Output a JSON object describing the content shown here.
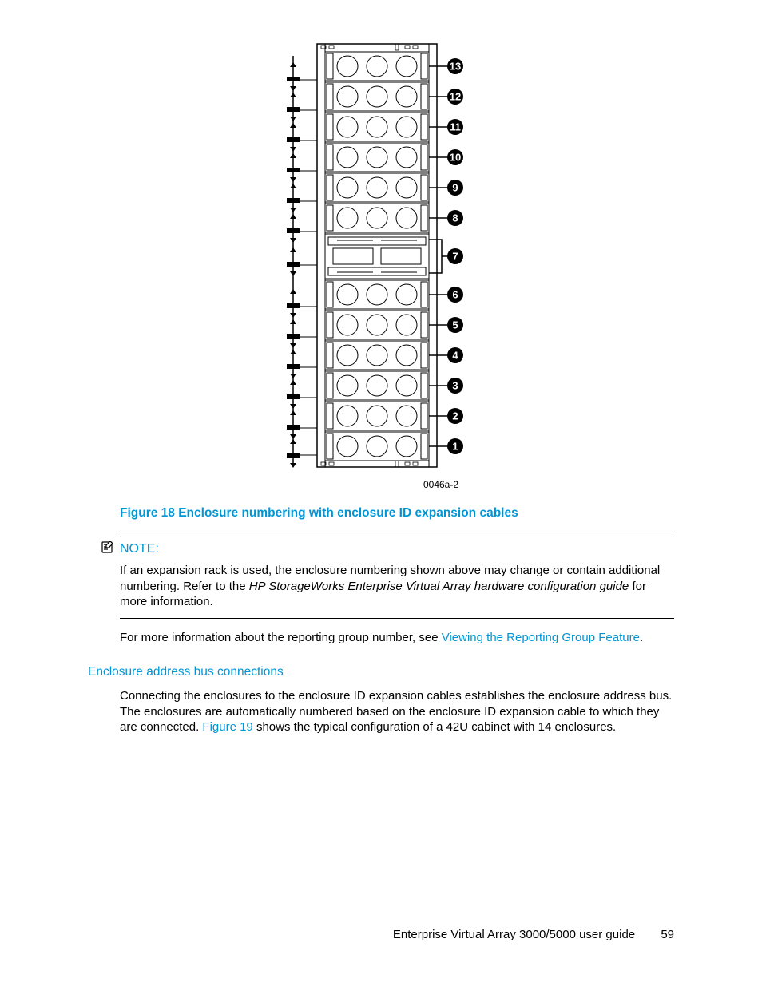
{
  "figure": {
    "image_id": "0046a-2",
    "caption": "Figure 18 Enclosure numbering with enclosure ID expansion cables",
    "callouts": [
      "13",
      "12",
      "11",
      "10",
      "9",
      "8",
      "7",
      "6",
      "5",
      "4",
      "3",
      "2",
      "1"
    ]
  },
  "note": {
    "label": "NOTE:",
    "text_pre": "If an expansion rack is used, the enclosure numbering shown above may change or contain additional numbering. Refer to the ",
    "text_italic": "HP StorageWorks Enterprise Virtual Array hardware configuration guide",
    "text_post": " for more information."
  },
  "after_note": {
    "text": "For more information about the reporting group number, see ",
    "link": "Viewing the Reporting Group Feature",
    "suffix": "."
  },
  "section": {
    "heading": "Enclosure address bus connections",
    "body_pre": "Connecting the enclosures to the enclosure ID expansion cables establishes the enclosure address bus. The enclosures are automatically numbered based on the enclosure ID expansion cable to which they are connected. ",
    "link": "Figure 19",
    "body_post": " shows the typical configuration of a 42U cabinet with 14 enclosures."
  },
  "footer": {
    "title": "Enterprise Virtual Array 3000/5000 user guide",
    "page": "59"
  }
}
